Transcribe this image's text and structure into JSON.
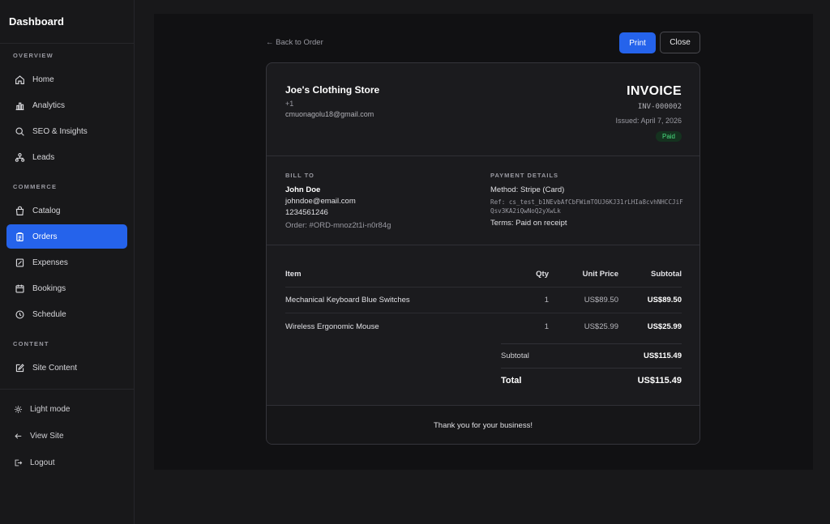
{
  "sidebar": {
    "brand": "Dashboard",
    "sections": {
      "overview": "OVERVIEW",
      "commerce": "COMMERCE",
      "content": "CONTENT"
    },
    "items": {
      "home": "Home",
      "analytics": "Analytics",
      "seo": "SEO & Insights",
      "leads": "Leads",
      "catalog": "Catalog",
      "orders": "Orders",
      "expenses": "Expenses",
      "bookings": "Bookings",
      "schedule": "Schedule",
      "site_content": "Site Content"
    },
    "active": "orders",
    "footer": {
      "light_mode": "Light mode",
      "view_site": "View Site",
      "logout": "Logout"
    }
  },
  "toolbar": {
    "back": "← Back to Order",
    "print": "Print",
    "close": "Close"
  },
  "invoice": {
    "store_name": "Joe's Clothing Store",
    "store_phone": "+1",
    "store_email": "cmuonagolu18@gmail.com",
    "title": "INVOICE",
    "number": "INV-000002",
    "issued": "Issued: April 7, 2026",
    "status": "Paid",
    "bill_to_label": "BILL TO",
    "bill_to": {
      "name": "John Doe",
      "email": "johndoe@email.com",
      "phone": "1234561246",
      "order": "Order: #ORD-mnoz2t1i-n0r84g"
    },
    "payment_label": "PAYMENT DETAILS",
    "payment": {
      "method": "Method: Stripe (Card)",
      "ref": "Ref: cs_test_b1NEvbAfCbFWimTOUJ6KJ31rLHIa8cvhNHCCJiFQsv3KA2iQwNoQ2yXwLk",
      "terms": "Terms: Paid on receipt"
    },
    "columns": {
      "item": "Item",
      "qty": "Qty",
      "unit": "Unit Price",
      "subtotal": "Subtotal"
    },
    "lines": [
      {
        "item": "Mechanical Keyboard Blue Switches",
        "qty": "1",
        "unit": "US$89.50",
        "subtotal": "US$89.50"
      },
      {
        "item": "Wireless Ergonomic Mouse",
        "qty": "1",
        "unit": "US$25.99",
        "subtotal": "US$25.99"
      }
    ],
    "subtotal_label": "Subtotal",
    "subtotal_value": "US$115.49",
    "total_label": "Total",
    "total_value": "US$115.49",
    "footer": "Thank you for your business!"
  },
  "colors": {
    "accent": "#2563eb",
    "paid": "#4ade80"
  }
}
